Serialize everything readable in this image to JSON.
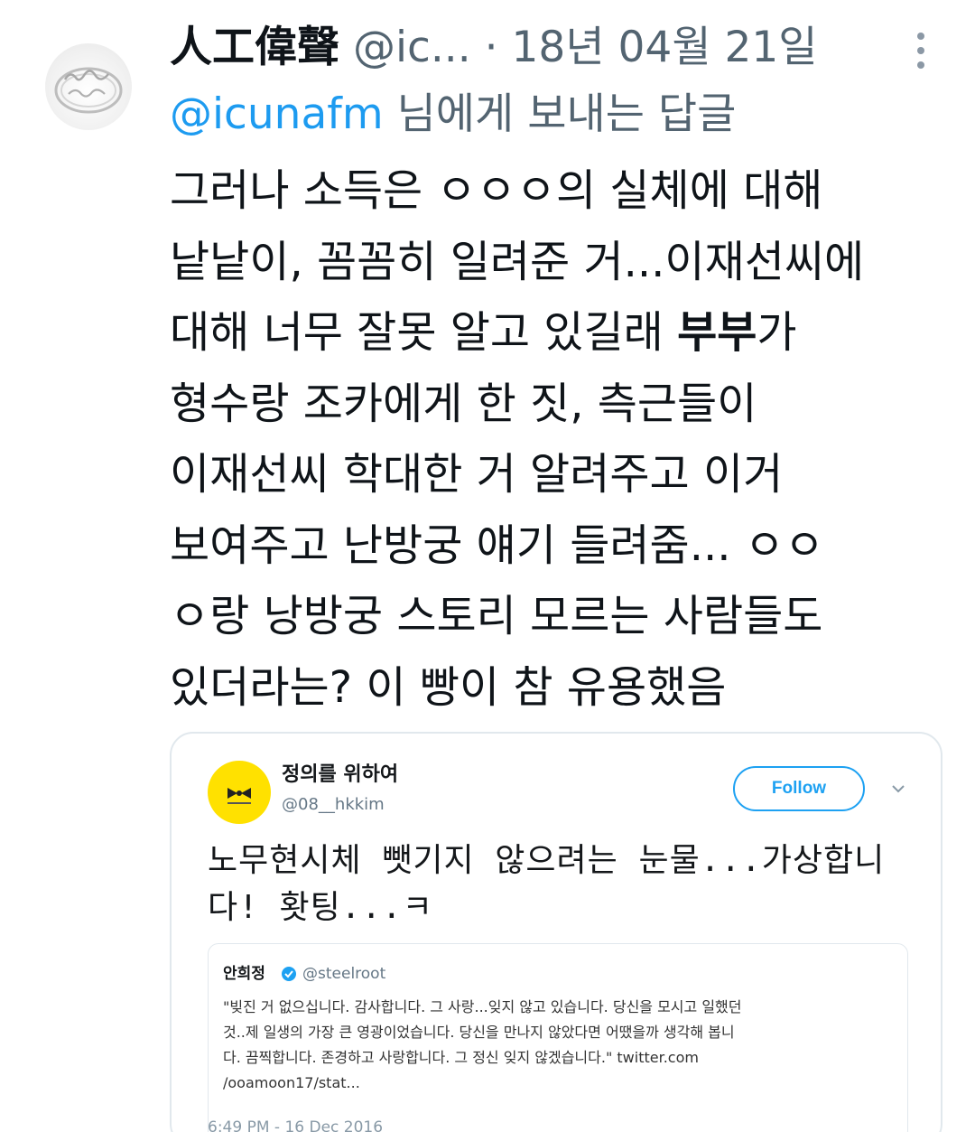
{
  "tweet": {
    "display_name": "人工偉聲",
    "handle": "@ic...",
    "separator": "·",
    "date": "18년 04월 21일",
    "reply_to_mention": "@icunafm",
    "reply_to_suffix": " 님에게 보내는 답글",
    "body": {
      "l1": "그러나 소득은 ㅇㅇㅇ의 실체에 대해",
      "l2": "낱낱이, 꼼꼼히 일려준 거...이재선씨에",
      "l3_a": "대해 너무 잘못 알고 있길래 ",
      "l3_b": "부부",
      "l3_c": "가",
      "l4": "형수랑 조카에게 한 짓, 측근들이",
      "l5": "이재선씨 학대한 거 알려주고 이거",
      "l6": "보여주고 난방궁 얘기 들려줌...  ㅇㅇ",
      "l7": "ㅇ랑 낭방궁 스토리 모르는 사람들도",
      "l8": "있더라는? 이 빵이 참 유용했음"
    },
    "avatar_icon": "ring-avatar-icon",
    "more_icon": "more-vertical-icon"
  },
  "embed": {
    "name": "정의를 위하여",
    "handle": "@08__hkkim",
    "follow_label": "Follow",
    "text_l1": "노무현시체 뺏기지 않으려는 눈물...가상합니",
    "text_l2": "다! 홧팅...ㅋ",
    "inner": {
      "name": "안희정",
      "handle": "@steelroot",
      "l1": "\"빚진 거 없으십니다. 감사합니다. 그 사랑...잊지 않고 있습니다. 당신을 모시고 일했던",
      "l2": "것..제 일생의 가장 큰 영광이었습니다. 당신을 만나지 않았다면 어땠을까 생각해 봅니",
      "l3": "다. 끔찍합니다. 존경하고 사랑합니다. 그 정신 잊지 않겠습니다.\" twitter.com",
      "l4": "/ooamoon17/stat..."
    },
    "time": "6:49 PM - 16 Dec 2016"
  },
  "colors": {
    "link": "#1d9bf0",
    "muted": "#536471",
    "follow": "#1da1f2",
    "embed_avatar": "#ffe100"
  }
}
